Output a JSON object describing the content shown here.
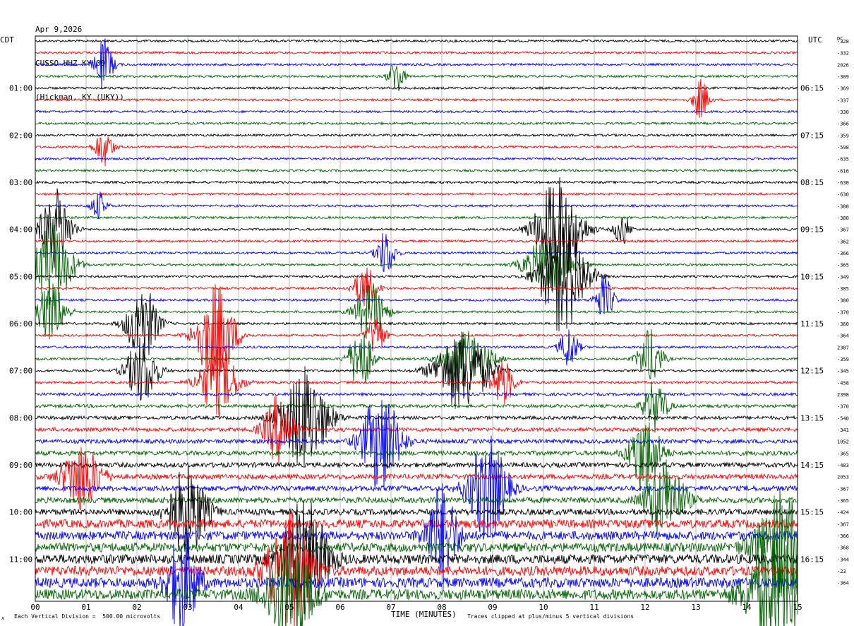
{
  "header": {
    "date": "Apr 9,2026",
    "station": "CUSSO HHZ KY 00",
    "location": "(Hickman, KY (UKY))"
  },
  "axes": {
    "left_label": "CDT",
    "right_label": "UTC",
    "dc_label": "DC",
    "xlabel": "TIME (MINUTES)"
  },
  "footer": {
    "scale_note": "Each Vertical Division =  500.00 microvolts",
    "clip_note": "Traces clipped at plus/minus 5 vertical divisions",
    "corner_mark": "ᴀ"
  },
  "colors": {
    "trace_cycle": [
      "#000000",
      "#ff0000",
      "#0000ff",
      "#006400"
    ],
    "grid": "#9a9a9a"
  },
  "chart_data": {
    "type": "helicorder",
    "x": {
      "min": 0,
      "max": 15,
      "ticks": [
        "00",
        "01",
        "02",
        "03",
        "04",
        "05",
        "06",
        "07",
        "08",
        "09",
        "10",
        "11",
        "12",
        "13",
        "14",
        "15"
      ]
    },
    "cdt_hour_labels": [
      "01:00",
      "02:00",
      "03:00",
      "04:00",
      "05:00",
      "06:00",
      "07:00",
      "08:00",
      "09:00",
      "10:00",
      "11:00"
    ],
    "utc_hour_labels": [
      "06:15",
      "07:15",
      "08:15",
      "09:15",
      "10:15",
      "11:15",
      "12:15",
      "13:15",
      "14:15",
      "15:15",
      "16:15"
    ],
    "dc_offsets": [
      "-328",
      "-332",
      "2026",
      "-309",
      "-369",
      "-337",
      "-330",
      "-366",
      "-359",
      "-598",
      "-635",
      "-616",
      "-630",
      "-630",
      "-388",
      "-380",
      "-367",
      "-362",
      "-366",
      "-365",
      "-349",
      "-385",
      "-380",
      "-370",
      "-360",
      "-364",
      "2387",
      "-359",
      "-345",
      "-458",
      "2398",
      "-370",
      "-540",
      "-341",
      "1052",
      "-365",
      "-483",
      "2053",
      "-367",
      "-365",
      "-424",
      "-367",
      "-366",
      "-368",
      "-344",
      "-23",
      "-364"
    ],
    "trace_count": 48,
    "minutes_per_line": 15,
    "events": [
      {
        "line": 2,
        "minute": 1.35,
        "amp": 2.2,
        "width": 0.12
      },
      {
        "line": 3,
        "minute": 7.1,
        "amp": 1.6,
        "width": 0.1
      },
      {
        "line": 5,
        "minute": 13.1,
        "amp": 1.8,
        "width": 0.1
      },
      {
        "line": 9,
        "minute": 1.35,
        "amp": 1.6,
        "width": 0.12
      },
      {
        "line": 14,
        "minute": 1.25,
        "amp": 1.2,
        "width": 0.1
      },
      {
        "line": 16,
        "minute": 0.4,
        "amp": 3.5,
        "width": 0.2
      },
      {
        "line": 16,
        "minute": 10.3,
        "amp": 4.5,
        "width": 0.3
      },
      {
        "line": 16,
        "minute": 11.55,
        "amp": 1.5,
        "width": 0.1
      },
      {
        "line": 18,
        "minute": 6.9,
        "amp": 2.0,
        "width": 0.12
      },
      {
        "line": 19,
        "minute": 0.35,
        "amp": 3.8,
        "width": 0.25
      },
      {
        "line": 19,
        "minute": 10.1,
        "amp": 2.5,
        "width": 0.3
      },
      {
        "line": 20,
        "minute": 10.4,
        "amp": 5.0,
        "width": 0.3
      },
      {
        "line": 21,
        "minute": 6.5,
        "amp": 2.0,
        "width": 0.15
      },
      {
        "line": 22,
        "minute": 11.2,
        "amp": 2.0,
        "width": 0.12
      },
      {
        "line": 23,
        "minute": 0.3,
        "amp": 2.5,
        "width": 0.2
      },
      {
        "line": 23,
        "minute": 6.6,
        "amp": 2.5,
        "width": 0.2
      },
      {
        "line": 24,
        "minute": 2.1,
        "amp": 3.5,
        "width": 0.2
      },
      {
        "line": 25,
        "minute": 3.55,
        "amp": 4.5,
        "width": 0.25
      },
      {
        "line": 25,
        "minute": 6.7,
        "amp": 1.8,
        "width": 0.12
      },
      {
        "line": 26,
        "minute": 10.5,
        "amp": 1.8,
        "width": 0.12
      },
      {
        "line": 27,
        "minute": 6.4,
        "amp": 3.0,
        "width": 0.15
      },
      {
        "line": 27,
        "minute": 8.5,
        "amp": 2.5,
        "width": 0.3
      },
      {
        "line": 27,
        "minute": 12.1,
        "amp": 2.5,
        "width": 0.15
      },
      {
        "line": 28,
        "minute": 2.1,
        "amp": 3.0,
        "width": 0.2
      },
      {
        "line": 28,
        "minute": 8.4,
        "amp": 3.5,
        "width": 0.35
      },
      {
        "line": 29,
        "minute": 3.6,
        "amp": 3.0,
        "width": 0.25
      },
      {
        "line": 29,
        "minute": 9.2,
        "amp": 2.0,
        "width": 0.15
      },
      {
        "line": 31,
        "minute": 12.2,
        "amp": 2.2,
        "width": 0.15
      },
      {
        "line": 32,
        "minute": 5.3,
        "amp": 4.5,
        "width": 0.3
      },
      {
        "line": 33,
        "minute": 4.8,
        "amp": 3.0,
        "width": 0.2
      },
      {
        "line": 34,
        "minute": 6.8,
        "amp": 4.5,
        "width": 0.25
      },
      {
        "line": 35,
        "minute": 12.0,
        "amp": 3.5,
        "width": 0.2
      },
      {
        "line": 37,
        "minute": 0.9,
        "amp": 3.0,
        "width": 0.25
      },
      {
        "line": 38,
        "minute": 8.9,
        "amp": 4.5,
        "width": 0.25
      },
      {
        "line": 39,
        "minute": 12.4,
        "amp": 3.5,
        "width": 0.25
      },
      {
        "line": 40,
        "minute": 3.0,
        "amp": 4.0,
        "width": 0.25
      },
      {
        "line": 42,
        "minute": 8.0,
        "amp": 4.5,
        "width": 0.2
      },
      {
        "line": 43,
        "minute": 14.7,
        "amp": 5.0,
        "width": 0.35
      },
      {
        "line": 44,
        "minute": 5.3,
        "amp": 5.0,
        "width": 0.3
      },
      {
        "line": 45,
        "minute": 5.0,
        "amp": 5.0,
        "width": 0.3
      },
      {
        "line": 46,
        "minute": 2.9,
        "amp": 4.5,
        "width": 0.2
      },
      {
        "line": 47,
        "minute": 5.0,
        "amp": 5.0,
        "width": 0.3
      },
      {
        "line": 47,
        "minute": 14.6,
        "amp": 5.0,
        "width": 0.4
      }
    ]
  }
}
